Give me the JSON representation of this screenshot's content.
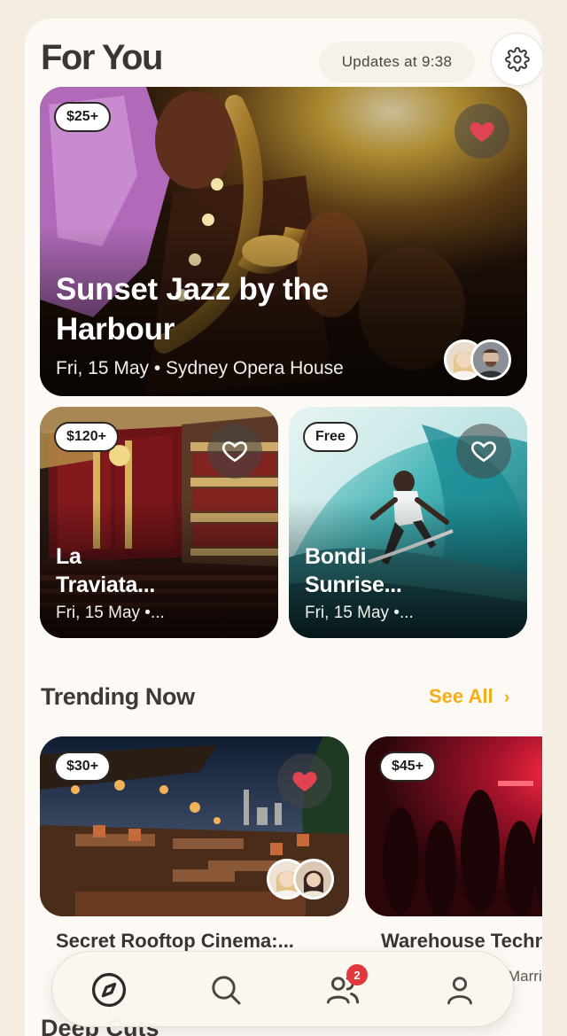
{
  "header": {
    "title": "For You",
    "updates": "Updates at 9:38"
  },
  "featured": {
    "price": "$25+",
    "title": "Sunset Jazz by the Harbour",
    "meta": "Fri, 15 May • Sydney Opera House",
    "favorited": true
  },
  "cards": [
    {
      "price": "$120+",
      "title": "La Traviata...",
      "title_lines": [
        "La",
        "Traviata..."
      ],
      "meta": "Fri, 15 May •...",
      "favorited": false
    },
    {
      "price": "Free",
      "title": "Bondi Sunrise...",
      "title_lines": [
        "Bondi",
        "Sunrise..."
      ],
      "meta": "Fri, 15 May •...",
      "favorited": false
    }
  ],
  "trending": {
    "title": "Trending Now",
    "see_all": "See All",
    "items": [
      {
        "price": "$30+",
        "title": "Secret Rooftop Cinema:...",
        "favorited": true
      },
      {
        "price": "$45+",
        "title": "Warehouse Techno",
        "sub": "Marri",
        "favorited": false
      }
    ]
  },
  "deep_cuts": {
    "title": "Deep Cuts"
  },
  "tabs": [
    {
      "name": "explore",
      "icon": "compass-icon",
      "active": true
    },
    {
      "name": "search",
      "icon": "search-icon"
    },
    {
      "name": "friends",
      "icon": "people-icon",
      "badge": "2"
    },
    {
      "name": "profile",
      "icon": "person-icon"
    }
  ],
  "colors": {
    "background": "#f4ede2",
    "accent": "#f3ad16",
    "heart": "#e04452",
    "badge": "#e1383e"
  }
}
